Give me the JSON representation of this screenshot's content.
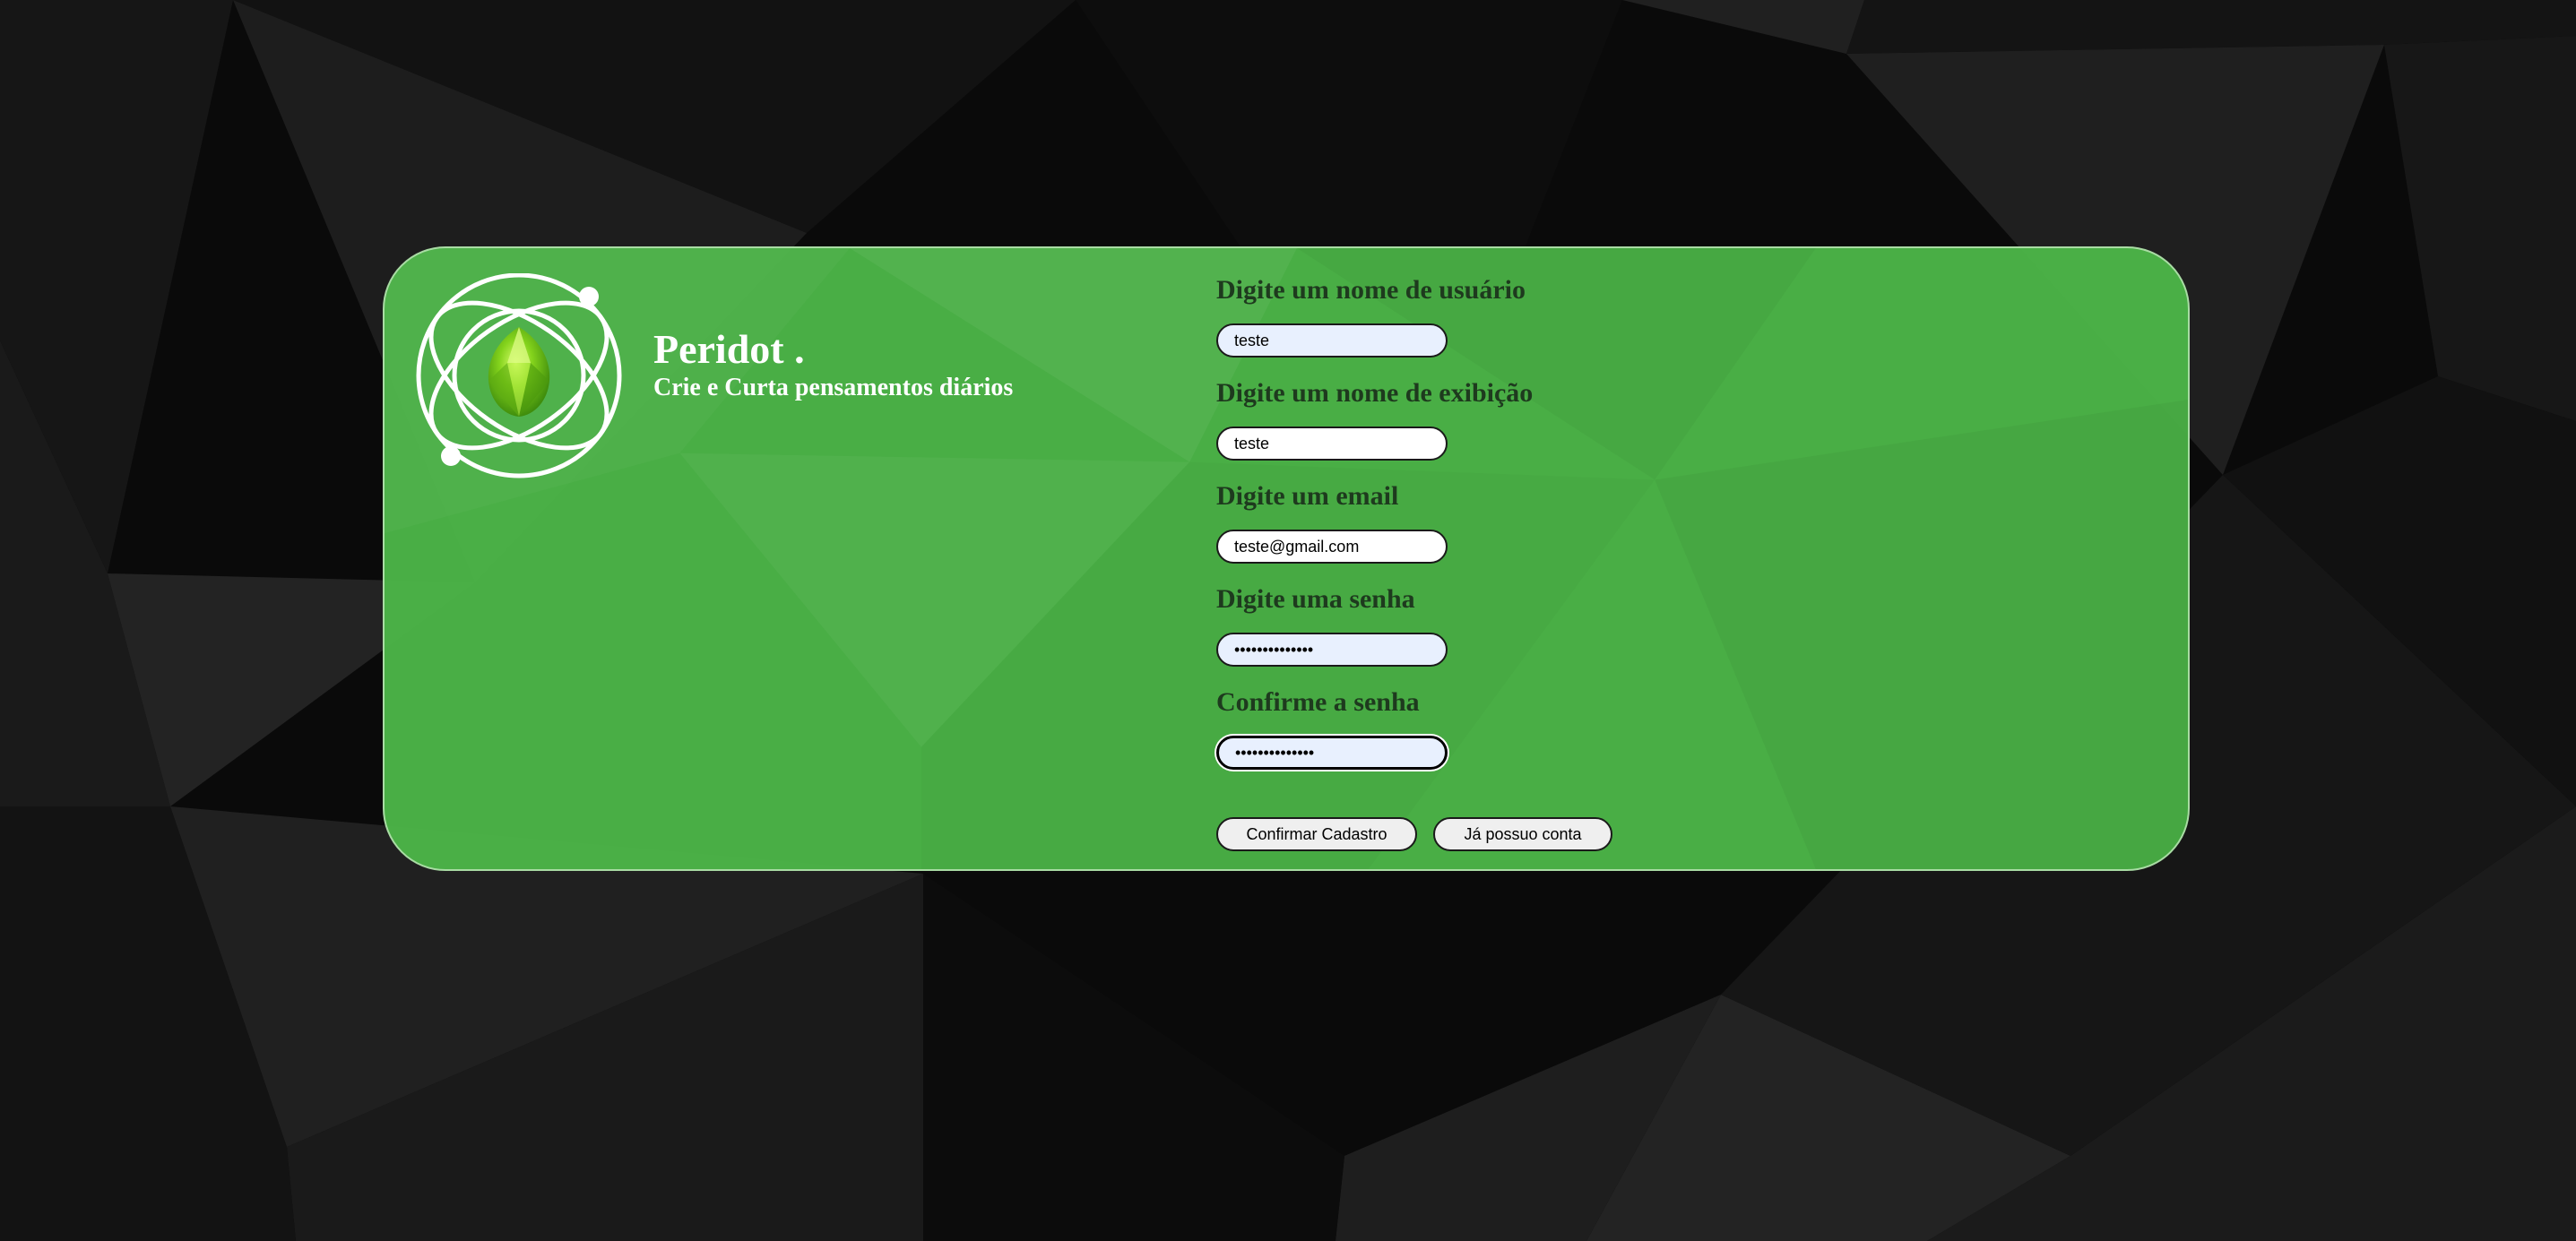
{
  "brand": {
    "title": "Peridot .",
    "tagline": "Crie e Curta pensamentos diários",
    "logo_icon": "peridot-gem-orbit-logo"
  },
  "form": {
    "fields": [
      {
        "label": "Digite um nome de usuário",
        "value": "teste",
        "type": "text"
      },
      {
        "label": "Digite um nome de exibição",
        "value": "teste",
        "type": "text"
      },
      {
        "label": "Digite um email",
        "value": "teste@gmail.com",
        "type": "email"
      },
      {
        "label": "Digite uma senha",
        "value": "••••••••••••••",
        "type": "password"
      },
      {
        "label": "Confirme a senha",
        "value": "••••••••••••••",
        "type": "password"
      }
    ],
    "confirm_button": "Confirmar Cadastro",
    "login_button": "Já possuo conta"
  },
  "colors": {
    "background": "#0b0b0b",
    "card": "#4cb548",
    "label_text": "#1e3a1e",
    "brand_text": "#ffffff"
  }
}
